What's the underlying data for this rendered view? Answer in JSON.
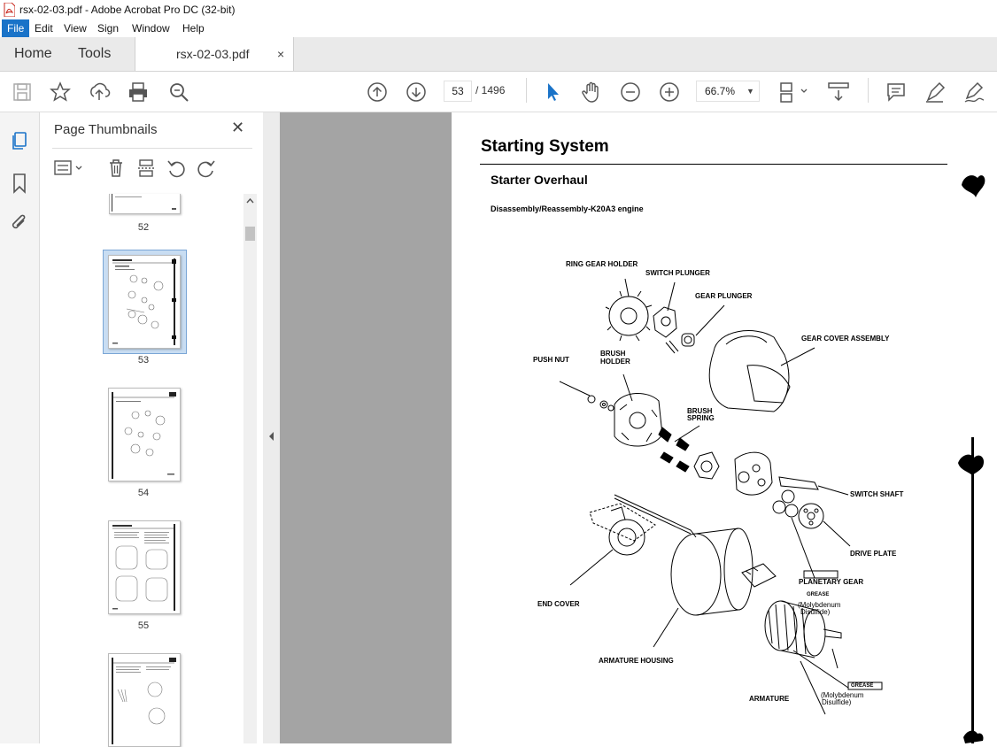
{
  "window": {
    "title": "rsx-02-03.pdf - Adobe Acrobat Pro DC (32-bit)"
  },
  "menu": [
    "File",
    "Edit",
    "View",
    "Sign",
    "Window",
    "Help"
  ],
  "tabs": {
    "home": "Home",
    "tools": "Tools",
    "document": "rsx-02-03.pdf",
    "close": "×"
  },
  "toolbar": {
    "current_page": "53",
    "page_total": "/ 1496",
    "zoom": "66.7%",
    "accent": "#1a73c8"
  },
  "thumbnails": {
    "title": "Page Thumbnails",
    "close": "✕",
    "pages": [
      "52",
      "53",
      "54",
      "55"
    ]
  },
  "document": {
    "heading": "Starting System",
    "subheading": "Starter Overhaul",
    "caption": "Disassembly/Reassembly-K20A3 engine",
    "labels": {
      "ring_gear_holder": "RING GEAR HOLDER",
      "switch_plunger": "SWITCH PLUNGER",
      "gear_plunger": "GEAR PLUNGER",
      "gear_cover_assembly": "GEAR COVER ASSEMBLY",
      "push_nut": "PUSH NUT",
      "brush_holder_1": "BRUSH",
      "brush_holder_2": "HOLDER",
      "brush_spring_1": "BRUSH",
      "brush_spring_2": "SPRING",
      "switch_shaft": "SWITCH SHAFT",
      "drive_plate": "DRIVE PLATE",
      "planetary_gear": "PLANETARY GEAR",
      "grease_1": "GREASE",
      "moly_1a": "(Molybdenum",
      "moly_1b": "Disulfide)",
      "end_cover": "END COVER",
      "armature_housing": "ARMATURE HOUSING",
      "armature": "ARMATURE",
      "grease_2": "GREASE",
      "moly_2a": "(Molybdenum",
      "moly_2b": "Disulfide)"
    }
  }
}
